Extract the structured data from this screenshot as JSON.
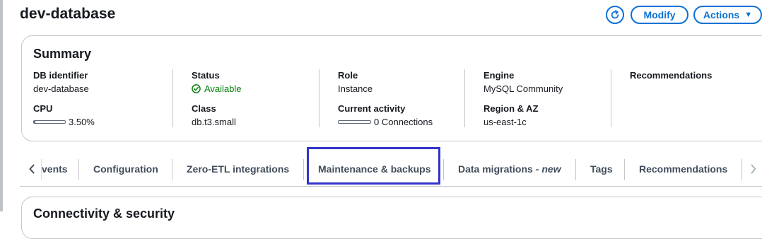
{
  "page": {
    "title": "dev-database"
  },
  "header_actions": {
    "refresh_icon": "refresh-icon",
    "modify_label": "Modify",
    "actions_label": "Actions"
  },
  "summary": {
    "title": "Summary",
    "fields": {
      "db_identifier_label": "DB identifier",
      "db_identifier_value": "dev-database",
      "cpu_label": "CPU",
      "cpu_value": "3.50%",
      "cpu_fraction": 0.035,
      "status_label": "Status",
      "status_value": "Available",
      "status_color": "#037f0c",
      "class_label": "Class",
      "class_value": "db.t3.small",
      "role_label": "Role",
      "role_value": "Instance",
      "activity_label": "Current activity",
      "activity_value": "0 Connections",
      "activity_fraction": 0,
      "engine_label": "Engine",
      "engine_value": "MySQL Community",
      "region_label": "Region & AZ",
      "region_value": "us-east-1c",
      "recommendations_label": "Recommendations"
    }
  },
  "tabs": {
    "items": [
      {
        "label": "vents"
      },
      {
        "label": "Configuration"
      },
      {
        "label": "Zero-ETL integrations"
      },
      {
        "label": "Maintenance & backups"
      },
      {
        "label": "Data migrations -",
        "suffix": "new"
      },
      {
        "label": "Tags"
      },
      {
        "label": "Recommendations"
      }
    ],
    "active_index": 3
  },
  "bottom_section": {
    "title": "Connectivity & security"
  },
  "colors": {
    "accent": "#0972d3",
    "focus_ring": "#3333cc",
    "border": "#c6c6cd",
    "text": "#16191f"
  }
}
